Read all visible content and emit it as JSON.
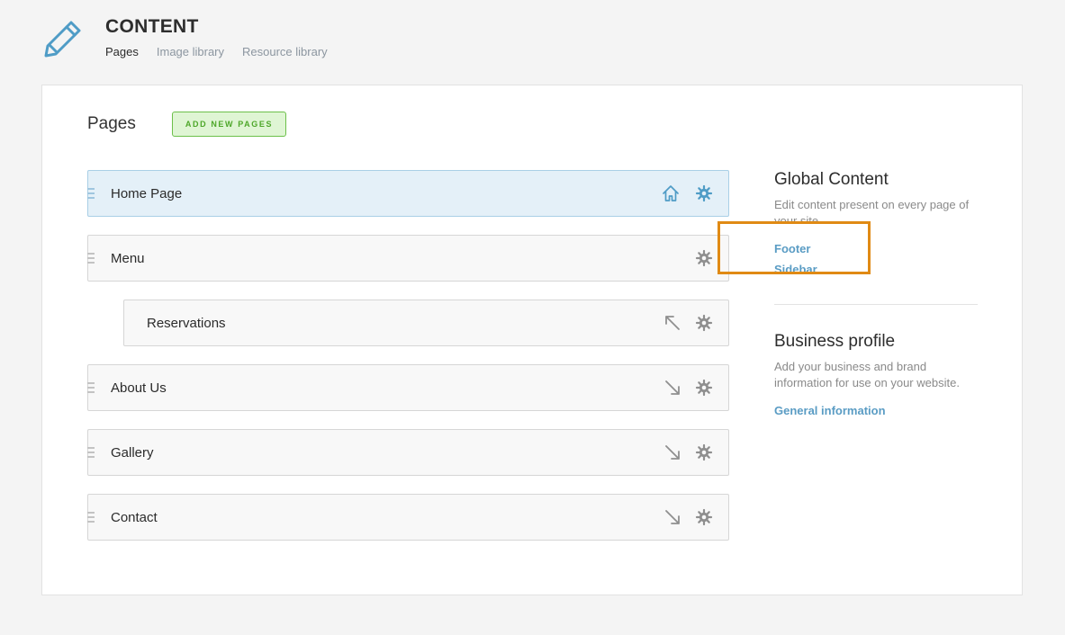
{
  "header": {
    "title": "CONTENT",
    "logo_icon": "pencil-icon",
    "tabs": [
      {
        "label": "Pages",
        "active": true
      },
      {
        "label": "Image library",
        "active": false
      },
      {
        "label": "Resource library",
        "active": false
      }
    ]
  },
  "pages_section": {
    "heading": "Pages",
    "add_button_label": "ADD NEW PAGES",
    "pages": [
      {
        "label": "Home Page",
        "level": 0,
        "icons": [
          "home-icon",
          "gear-icon"
        ]
      },
      {
        "label": "Menu",
        "level": 0,
        "icons": [
          "gear-icon"
        ]
      },
      {
        "label": "Reservations",
        "level": 1,
        "icons": [
          "arrow-up-left-icon",
          "gear-icon"
        ]
      },
      {
        "label": "About Us",
        "level": 0,
        "icons": [
          "arrow-down-right-icon",
          "gear-icon"
        ]
      },
      {
        "label": "Gallery",
        "level": 0,
        "icons": [
          "arrow-down-right-icon",
          "gear-icon"
        ]
      },
      {
        "label": "Contact",
        "level": 0,
        "icons": [
          "arrow-down-right-icon",
          "gear-icon"
        ]
      }
    ]
  },
  "global_content": {
    "title": "Global Content",
    "description": "Edit content present on every page of your site.",
    "links": [
      "Footer",
      "Sidebar"
    ]
  },
  "business_profile": {
    "title": "Business profile",
    "description": "Add your business and brand information for use on your website.",
    "link": "General information"
  },
  "colors": {
    "accent_blue": "#5a9cc4",
    "add_button_green": "#4ea72a",
    "highlight_orange": "#e08a14",
    "home_row_bg": "#e4f0f8"
  }
}
